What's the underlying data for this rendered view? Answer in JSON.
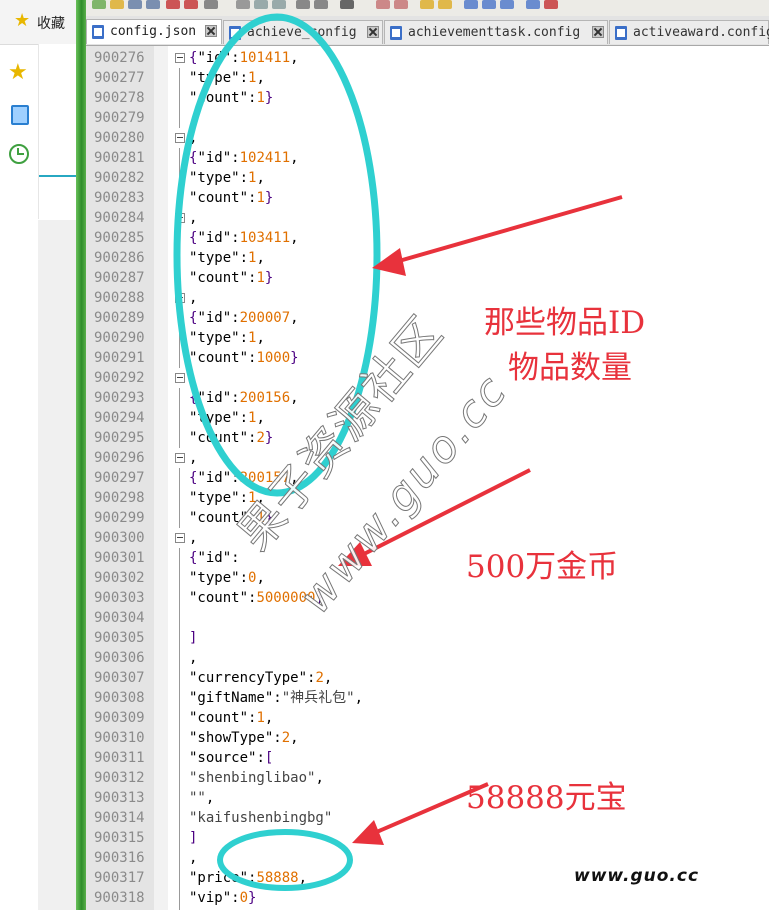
{
  "sidebar": {
    "favorites_label": "收藏",
    "icons": [
      "star-icon",
      "tablet-icon",
      "clock-icon"
    ]
  },
  "tabs": [
    {
      "label": "config.json",
      "active": true
    },
    {
      "label": "achieve_config",
      "active": false
    },
    {
      "label": "achievementtask.config",
      "active": false
    },
    {
      "label": "activeaward.config",
      "active": false
    }
  ],
  "lines": [
    {
      "n": "900276",
      "fold": true,
      "tokens": [
        [
          "brace",
          "{"
        ],
        [
          "key",
          "\"id\""
        ],
        [
          "pun",
          ":"
        ],
        [
          "num",
          "101411"
        ],
        [
          "pun",
          ","
        ]
      ]
    },
    {
      "n": "900277",
      "fold": false,
      "tokens": [
        [
          "key",
          "\"type\""
        ],
        [
          "pun",
          ":"
        ],
        [
          "num",
          "1"
        ],
        [
          "pun",
          ","
        ]
      ]
    },
    {
      "n": "900278",
      "fold": false,
      "tokens": [
        [
          "key",
          "\"count\""
        ],
        [
          "pun",
          ":"
        ],
        [
          "num",
          "1"
        ],
        [
          "brace",
          "}"
        ]
      ]
    },
    {
      "n": "900279",
      "fold": false,
      "tokens": []
    },
    {
      "n": "900280",
      "fold": true,
      "tokens": [
        [
          "pun",
          ","
        ]
      ]
    },
    {
      "n": "900281",
      "fold": false,
      "tokens": [
        [
          "brace",
          "{"
        ],
        [
          "key",
          "\"id\""
        ],
        [
          "pun",
          ":"
        ],
        [
          "num",
          "102411"
        ],
        [
          "pun",
          ","
        ]
      ]
    },
    {
      "n": "900282",
      "fold": false,
      "tokens": [
        [
          "key",
          "\"type\""
        ],
        [
          "pun",
          ":"
        ],
        [
          "num",
          "1"
        ],
        [
          "pun",
          ","
        ]
      ]
    },
    {
      "n": "900283",
      "fold": false,
      "tokens": [
        [
          "key",
          "\"count\""
        ],
        [
          "pun",
          ":"
        ],
        [
          "num",
          "1"
        ],
        [
          "brace",
          "}"
        ]
      ]
    },
    {
      "n": "900284",
      "fold": true,
      "tokens": [
        [
          "pun",
          ","
        ]
      ]
    },
    {
      "n": "900285",
      "fold": false,
      "tokens": [
        [
          "brace",
          "{"
        ],
        [
          "key",
          "\"id\""
        ],
        [
          "pun",
          ":"
        ],
        [
          "num",
          "103411"
        ],
        [
          "pun",
          ","
        ]
      ]
    },
    {
      "n": "900286",
      "fold": false,
      "tokens": [
        [
          "key",
          "\"type\""
        ],
        [
          "pun",
          ":"
        ],
        [
          "num",
          "1"
        ],
        [
          "pun",
          ","
        ]
      ]
    },
    {
      "n": "900287",
      "fold": false,
      "tokens": [
        [
          "key",
          "\"count\""
        ],
        [
          "pun",
          ":"
        ],
        [
          "num",
          "1"
        ],
        [
          "brace",
          "}"
        ]
      ]
    },
    {
      "n": "900288",
      "fold": true,
      "tokens": [
        [
          "pun",
          ","
        ]
      ]
    },
    {
      "n": "900289",
      "fold": false,
      "tokens": [
        [
          "brace",
          "{"
        ],
        [
          "key",
          "\"id\""
        ],
        [
          "pun",
          ":"
        ],
        [
          "num",
          "200007"
        ],
        [
          "pun",
          ","
        ]
      ]
    },
    {
      "n": "900290",
      "fold": false,
      "tokens": [
        [
          "key",
          "\"type\""
        ],
        [
          "pun",
          ":"
        ],
        [
          "num",
          "1"
        ],
        [
          "pun",
          ","
        ]
      ]
    },
    {
      "n": "900291",
      "fold": false,
      "tokens": [
        [
          "key",
          "\"count\""
        ],
        [
          "pun",
          ":"
        ],
        [
          "num",
          "1000"
        ],
        [
          "brace",
          "}"
        ]
      ]
    },
    {
      "n": "900292",
      "fold": true,
      "tokens": [
        [
          "pun",
          ","
        ]
      ]
    },
    {
      "n": "900293",
      "fold": false,
      "tokens": [
        [
          "brace",
          "{"
        ],
        [
          "key",
          "\"id\""
        ],
        [
          "pun",
          ":"
        ],
        [
          "num",
          "200156"
        ],
        [
          "pun",
          ","
        ]
      ]
    },
    {
      "n": "900294",
      "fold": false,
      "tokens": [
        [
          "key",
          "\"type\""
        ],
        [
          "pun",
          ":"
        ],
        [
          "num",
          "1"
        ],
        [
          "pun",
          ","
        ]
      ]
    },
    {
      "n": "900295",
      "fold": false,
      "tokens": [
        [
          "key",
          "\"count\""
        ],
        [
          "pun",
          ":"
        ],
        [
          "num",
          "2"
        ],
        [
          "brace",
          "}"
        ]
      ]
    },
    {
      "n": "900296",
      "fold": true,
      "tokens": [
        [
          "pun",
          ","
        ]
      ]
    },
    {
      "n": "900297",
      "fold": false,
      "tokens": [
        [
          "brace",
          "{"
        ],
        [
          "key",
          "\"id\""
        ],
        [
          "pun",
          ":"
        ],
        [
          "num",
          "200157"
        ],
        [
          "pun",
          ","
        ]
      ]
    },
    {
      "n": "900298",
      "fold": false,
      "tokens": [
        [
          "key",
          "\"type\""
        ],
        [
          "pun",
          ":"
        ],
        [
          "num",
          "1"
        ],
        [
          "pun",
          ","
        ]
      ]
    },
    {
      "n": "900299",
      "fold": false,
      "tokens": [
        [
          "key",
          "\"count\""
        ],
        [
          "pun",
          ":"
        ],
        [
          "num",
          "1"
        ],
        [
          "brace",
          "}"
        ]
      ]
    },
    {
      "n": "900300",
      "fold": true,
      "tokens": [
        [
          "pun",
          ","
        ]
      ]
    },
    {
      "n": "900301",
      "fold": false,
      "tokens": [
        [
          "brace",
          "{"
        ],
        [
          "key",
          "\"id\""
        ],
        [
          "pun",
          ":"
        ]
      ]
    },
    {
      "n": "900302",
      "fold": false,
      "tokens": [
        [
          "key",
          "\"type\""
        ],
        [
          "pun",
          ":"
        ],
        [
          "num",
          "0"
        ],
        [
          "pun",
          ","
        ]
      ]
    },
    {
      "n": "900303",
      "fold": false,
      "tokens": [
        [
          "key",
          "\"count\""
        ],
        [
          "pun",
          ":"
        ],
        [
          "num",
          "5000000"
        ],
        [
          "brace",
          "}"
        ]
      ]
    },
    {
      "n": "900304",
      "fold": false,
      "tokens": []
    },
    {
      "n": "900305",
      "fold": false,
      "tokens": [
        [
          "brace",
          "]"
        ]
      ]
    },
    {
      "n": "900306",
      "fold": false,
      "tokens": [
        [
          "pun",
          ","
        ]
      ]
    },
    {
      "n": "900307",
      "fold": false,
      "tokens": [
        [
          "key",
          "\"currencyType\""
        ],
        [
          "pun",
          ":"
        ],
        [
          "num",
          "2"
        ],
        [
          "pun",
          ","
        ]
      ]
    },
    {
      "n": "900308",
      "fold": false,
      "tokens": [
        [
          "key",
          "\"giftName\""
        ],
        [
          "pun",
          ":"
        ],
        [
          "str",
          "\"神兵礼包\""
        ],
        [
          "pun",
          ","
        ]
      ]
    },
    {
      "n": "900309",
      "fold": false,
      "tokens": [
        [
          "key",
          "\"count\""
        ],
        [
          "pun",
          ":"
        ],
        [
          "num",
          "1"
        ],
        [
          "pun",
          ","
        ]
      ]
    },
    {
      "n": "900310",
      "fold": false,
      "tokens": [
        [
          "key",
          "\"showType\""
        ],
        [
          "pun",
          ":"
        ],
        [
          "num",
          "2"
        ],
        [
          "pun",
          ","
        ]
      ]
    },
    {
      "n": "900311",
      "fold": false,
      "tokens": [
        [
          "key",
          "\"source\""
        ],
        [
          "pun",
          ":"
        ],
        [
          "brace",
          "["
        ]
      ]
    },
    {
      "n": "900312",
      "fold": false,
      "tokens": [
        [
          "str",
          "\"shenbinglibao\""
        ],
        [
          "pun",
          ","
        ]
      ]
    },
    {
      "n": "900313",
      "fold": false,
      "tokens": [
        [
          "str",
          "\"\""
        ],
        [
          "pun",
          ","
        ]
      ]
    },
    {
      "n": "900314",
      "fold": false,
      "tokens": [
        [
          "str",
          "\"kaifushenbingbg\""
        ]
      ]
    },
    {
      "n": "900315",
      "fold": false,
      "tokens": [
        [
          "brace",
          "]"
        ]
      ]
    },
    {
      "n": "900316",
      "fold": false,
      "tokens": [
        [
          "pun",
          ","
        ]
      ]
    },
    {
      "n": "900317",
      "fold": false,
      "tokens": [
        [
          "key",
          "\"price\""
        ],
        [
          "pun",
          ":"
        ],
        [
          "num",
          "58888"
        ],
        [
          "pun",
          ","
        ]
      ]
    },
    {
      "n": "900318",
      "fold": false,
      "tokens": [
        [
          "key",
          "\"vip\""
        ],
        [
          "pun",
          ":"
        ],
        [
          "num",
          "0"
        ],
        [
          "brace",
          "}"
        ]
      ]
    },
    {
      "n": "",
      "fold": false,
      "tokens": [
        [
          "pun",
          ","
        ]
      ]
    }
  ],
  "annotations": {
    "item_note_line1": "那些物品ID",
    "item_note_line2": "物品数量",
    "gold_note": "500万金币",
    "yuanbao_note": "58888元宝",
    "accent_color": "#e8323c",
    "circle_color": "#2fd0d0"
  },
  "watermark": {
    "chinese": "果子资源社区",
    "url": "www.guo.cc",
    "corner": "www.guo.cc"
  }
}
